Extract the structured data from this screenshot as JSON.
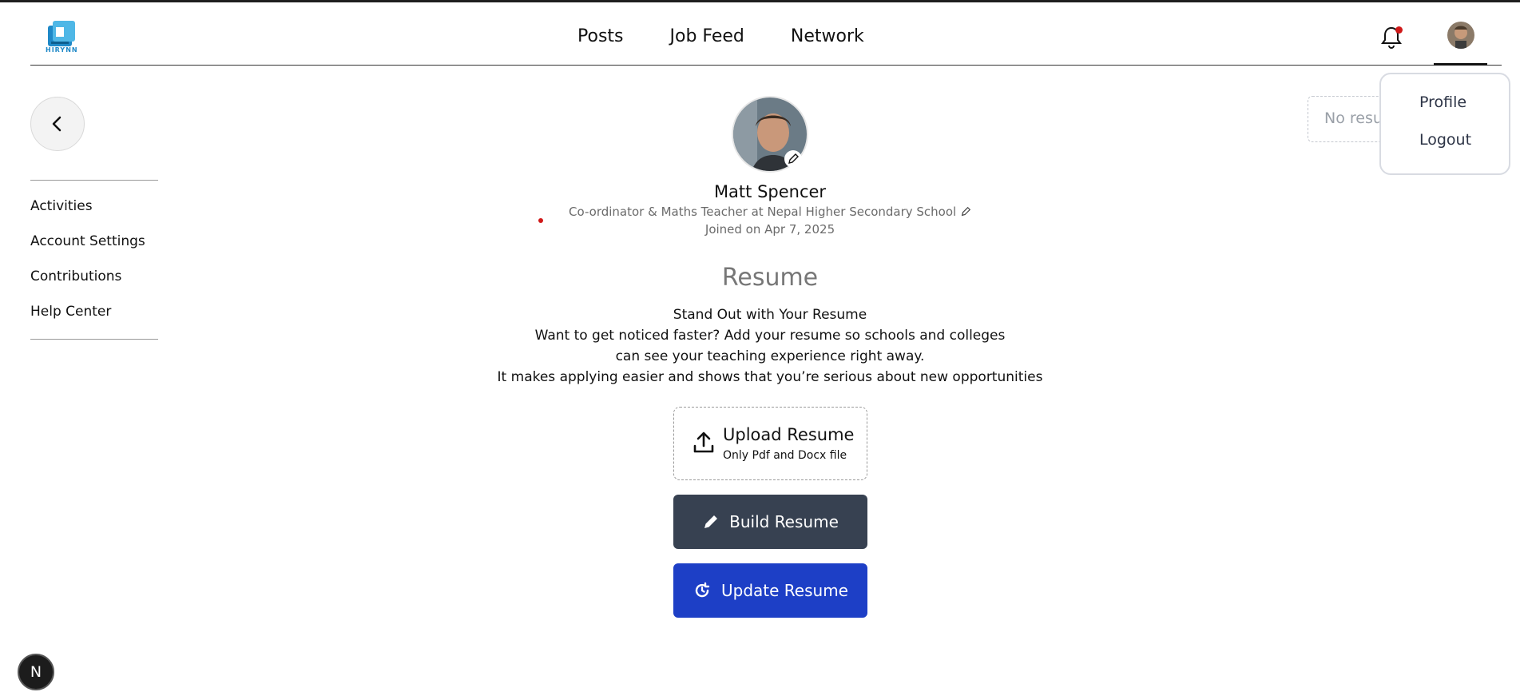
{
  "brand": {
    "name": "HIRYNN",
    "accent": "#1e88c7"
  },
  "nav": {
    "items": [
      "Posts",
      "Job Feed",
      "Network"
    ]
  },
  "header": {
    "notification_icon": "bell-icon",
    "has_unread": true
  },
  "dropdown": {
    "profile": "Profile",
    "logout": "Logout"
  },
  "resume_status": "No resume uploaded",
  "sidebar": {
    "items": [
      "Activities",
      "Account Settings",
      "Contributions",
      "Help Center"
    ]
  },
  "profile": {
    "name": "Matt Spencer",
    "headline": "Co-ordinator & Maths Teacher at Nepal Higher Secondary School",
    "joined": "Joined on Apr 7, 2025"
  },
  "resume": {
    "title": "Resume",
    "lines": [
      "Stand Out with Your Resume",
      "Want to get noticed faster? Add your resume so schools and colleges",
      "can see your teaching experience right away.",
      "It makes applying easier and shows that you’re serious about new opportunities"
    ],
    "upload_title": "Upload Resume",
    "upload_sub": "Only Pdf and Docx file",
    "build_label": "Build Resume",
    "update_label": "Update Resume"
  },
  "dev_badge": "N",
  "colors": {
    "build_button": "#374151",
    "update_button": "#1d3fc6",
    "notification_dot": "#d01919"
  }
}
